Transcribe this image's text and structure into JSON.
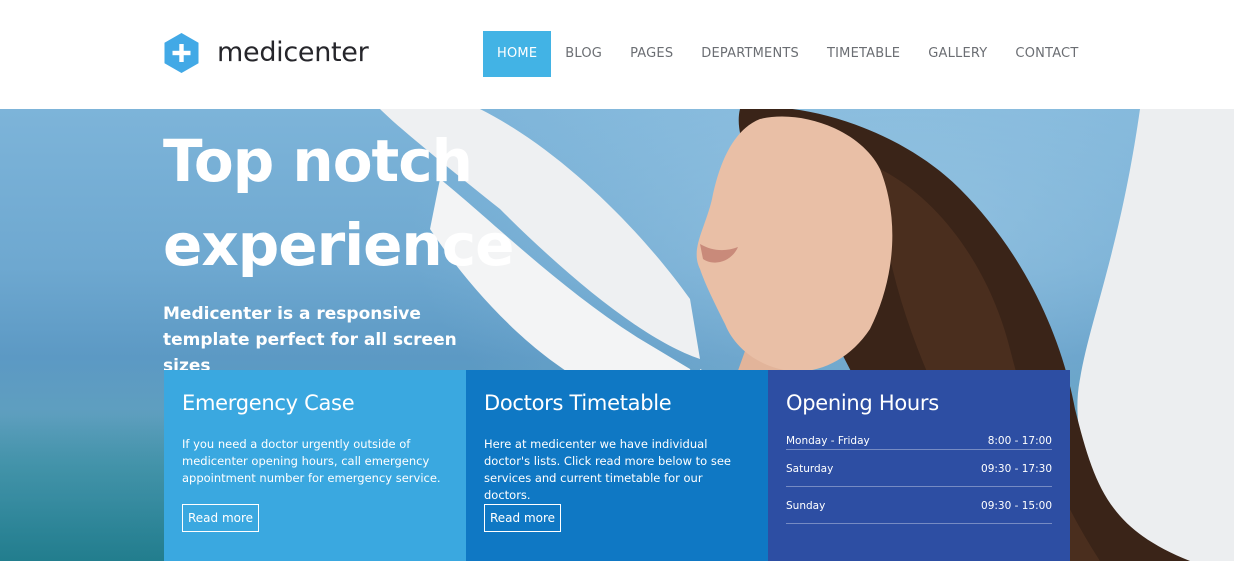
{
  "brand": {
    "name": "medicenter",
    "color": "#42a9e6"
  },
  "nav": {
    "items": [
      {
        "label": "HOME",
        "active": true
      },
      {
        "label": "BLOG"
      },
      {
        "label": "PAGES"
      },
      {
        "label": "DEPARTMENTS"
      },
      {
        "label": "TIMETABLE"
      },
      {
        "label": "GALLERY"
      },
      {
        "label": "CONTACT"
      }
    ],
    "active_color": "#42b3e5"
  },
  "hero": {
    "title": "Top notch experience",
    "subtitle": "Medicenter is a responsive template perfect for all screen sizes"
  },
  "boxes": [
    {
      "title": "Emergency Case",
      "text": "If you need a doctor urgently outside of medicenter opening hours, call emergency appointment number for emergency service.",
      "button": "Read more",
      "color": "#3aa8e0"
    },
    {
      "title": "Doctors Timetable",
      "text": "Here at medicenter we have individual doctor's lists. Click read more below to see services and current timetable for our doctors.",
      "button": "Read more",
      "color": "#0f78c4"
    },
    {
      "title": "Opening Hours",
      "color": "#2d4ea3",
      "hours": [
        {
          "day": "Monday - Friday",
          "time": "8:00 - 17:00"
        },
        {
          "day": "Saturday",
          "time": "09:30 - 17:30"
        },
        {
          "day": "Sunday",
          "time": "09:30 - 15:00"
        }
      ]
    }
  ]
}
